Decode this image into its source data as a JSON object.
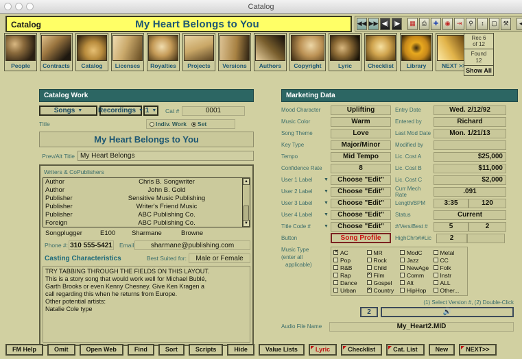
{
  "window": {
    "title": "Catalog"
  },
  "banner": {
    "module_label": "Catalog",
    "record_title": "My Heart Belongs to You"
  },
  "fm_toolbar": {
    "buttons": [
      {
        "name": "go-to-first-record",
        "glyph": "◀◀"
      },
      {
        "name": "go-to-last-record",
        "glyph": "▶▶"
      },
      {
        "name": "previous-record",
        "glyph": "◀|"
      },
      {
        "name": "next-record",
        "glyph": "|▶"
      },
      {
        "name": "layout-mode",
        "glyph": "▤"
      },
      {
        "name": "print",
        "glyph": "⎙"
      },
      {
        "name": "new-record",
        "glyph": "✚"
      },
      {
        "name": "delete-record",
        "glyph": "◉"
      },
      {
        "name": "export",
        "glyph": "⇥"
      },
      {
        "name": "find",
        "glyph": "🔍"
      },
      {
        "name": "sort",
        "glyph": "⬍"
      },
      {
        "name": "trash",
        "glyph": "Ὕ1"
      },
      {
        "name": "script",
        "glyph": "⚒"
      },
      {
        "name": "collapse-toolbar",
        "glyph": "◀"
      }
    ]
  },
  "record_counter": {
    "record_line1": "Rec 6",
    "record_line2": "of 12",
    "found_line1": "Found",
    "found_line2": "12",
    "show_all": "Show All"
  },
  "nav_tiles": [
    {
      "label": "People"
    },
    {
      "label": "Contracts"
    },
    {
      "label": "Catalog"
    },
    {
      "label": "Licenses"
    },
    {
      "label": "Royalties"
    },
    {
      "label": "Projects"
    },
    {
      "label": "Versions"
    },
    {
      "label": "Authors"
    },
    {
      "label": "Copyright"
    },
    {
      "label": "Lyric"
    },
    {
      "label": "Checklist"
    },
    {
      "label": "Library"
    },
    {
      "label": "NEXT >>"
    }
  ],
  "catalog_work": {
    "header": "Catalog Work",
    "songs_button": "Songs",
    "recordings_button": "Recordings",
    "version_number": "1",
    "cat_number_label": "Cat #",
    "cat_number_value": "0001",
    "title_label": "Title",
    "scope_indiv_label": "Indiv. Work",
    "scope_set_label": "Set",
    "scope_selected": "Set",
    "title_value": "My Heart Belongs to You",
    "prev_alt_title_label": "Prev/Alt Title",
    "prev_alt_title_value": "My Heart Belongs",
    "writers_header": "Writers & CoPublishers",
    "writers_rows": [
      {
        "type": "Author",
        "name": "Chris B. Songwriter"
      },
      {
        "type": "Author",
        "name": "John B. Gold"
      },
      {
        "type": "Publisher",
        "name": "Sensitive Music Publishing"
      },
      {
        "type": "Publisher",
        "name": "Writer's Friend Music"
      },
      {
        "type": "Publisher",
        "name": "ABC Publishing Co."
      },
      {
        "type": "Foreign",
        "name": "ABC Publishing Co."
      }
    ],
    "songplugger_role": "Songplugger",
    "songplugger_code": "E100",
    "songplugger_first": "Sharmane",
    "songplugger_last": "Browne",
    "phone_label": "Phone #:",
    "phone_value": "310 555-5421",
    "email_label": "Email",
    "email_value": "sharmane@publishing.com",
    "casting_header": "Casting Characteristics",
    "best_suited_label": "Best Suited for:",
    "best_suited_value": "Male or Female",
    "notes": "TRY TABBING THROUGH THE FIELDS ON THIS LAYOUT.\nThis is a story song that would work well for Michael Bublé,\nGarth Brooks or even Kenny Chesney. Give Ken Kragen a\ncall regarding this when he returns from Europe.\nOther potential artists:\nNatalie Cole type"
  },
  "marketing": {
    "header": "Marketing Data",
    "left_rows": [
      {
        "label": "Mood Character",
        "value": "Uplifting",
        "has_caret": false
      },
      {
        "label": "Music Color",
        "value": "Warm",
        "has_caret": false
      },
      {
        "label": "Song Theme",
        "value": "Love",
        "has_caret": false
      },
      {
        "label": "Key Type",
        "value": "Major/Minor",
        "has_caret": false
      },
      {
        "label": "Tempo",
        "value": "Mid Tempo",
        "has_caret": false
      },
      {
        "label": "Confidence Rate",
        "value": "8",
        "has_caret": false
      },
      {
        "label": "User 1 Label",
        "value": "Choose \"Edit\"",
        "has_caret": true
      },
      {
        "label": "User 2 Label",
        "value": "Choose \"Edit\"",
        "has_caret": true
      },
      {
        "label": "User 3 Label",
        "value": "Choose \"Edit\"",
        "has_caret": true
      },
      {
        "label": "User 4 Label",
        "value": "Choose \"Edit\"",
        "has_caret": true
      },
      {
        "label": "Title Code #",
        "value": "Choose \"Edit\"",
        "has_caret": true
      }
    ],
    "right_rows": [
      {
        "label": "Entry Date",
        "value": "Wed. 2/12/92",
        "align": "center"
      },
      {
        "label": "Entered by",
        "value": "Richard",
        "align": "center"
      },
      {
        "label": "Last Mod Date",
        "value": "Mon. 1/21/13",
        "align": "center"
      },
      {
        "label": "Modified by",
        "value": "",
        "align": "center"
      },
      {
        "label": "Lic. Cost A",
        "value": "$25,000",
        "align": "right"
      },
      {
        "label": "Lic. Cost B",
        "value": "$11,000",
        "align": "right"
      },
      {
        "label": "Lic. Cost C",
        "value": "$2,000",
        "align": "right"
      },
      {
        "label": "Curr Mech Rate",
        "value": ".091",
        "align": "center"
      }
    ],
    "length_bpm_label": "Length/BPM",
    "length_value": "3:35",
    "bpm_value": "120",
    "status_label": "Status",
    "status_value": "Current",
    "vers_best_label": "#/Vers/Best #",
    "vers_value": "5",
    "best_value": "2",
    "button_label": "Button",
    "song_profile_button": "Song Profile",
    "highchrt_label": "HighChrt#/#Lic",
    "highchrt_value": "2",
    "highchrt_value2": "",
    "music_type_label_1": "Music Type",
    "music_type_label_2": "(enter all",
    "music_type_label_3": "applicable)",
    "music_types": [
      {
        "label": "AC",
        "checked": true
      },
      {
        "label": "MR",
        "checked": false
      },
      {
        "label": "ModC",
        "checked": false
      },
      {
        "label": "Metal",
        "checked": false
      },
      {
        "label": "Pop",
        "checked": false
      },
      {
        "label": "Rock",
        "checked": false
      },
      {
        "label": "Jazz",
        "checked": false
      },
      {
        "label": "CC",
        "checked": false
      },
      {
        "label": "R&B",
        "checked": false
      },
      {
        "label": "Child",
        "checked": false
      },
      {
        "label": "NewAge",
        "checked": false
      },
      {
        "label": "Folk",
        "checked": false
      },
      {
        "label": "Rap",
        "checked": false
      },
      {
        "label": "Film",
        "checked": true
      },
      {
        "label": "Comm",
        "checked": false
      },
      {
        "label": "Instr",
        "checked": false
      },
      {
        "label": "Dance",
        "checked": false
      },
      {
        "label": "Gospel",
        "checked": false
      },
      {
        "label": "Alt",
        "checked": false
      },
      {
        "label": "ALL",
        "checked": false
      },
      {
        "label": "Urban",
        "checked": false
      },
      {
        "label": "Country",
        "checked": true
      },
      {
        "label": "HipHop",
        "checked": false
      },
      {
        "label": "Other...",
        "checked": false
      }
    ],
    "version_hint": "(1) Select Version #, (2) Double-Click",
    "version_number": "2",
    "play_icon": "speaker-icon",
    "audio_file_label": "Audio File Name",
    "audio_file_value": "My_Heart2.MID"
  },
  "bottom_buttons": [
    {
      "label": "FM Help",
      "flag": false,
      "red": false
    },
    {
      "label": "Omit",
      "flag": false,
      "red": false
    },
    {
      "label": "Open Web",
      "flag": false,
      "red": false
    },
    {
      "label": "Find",
      "flag": false,
      "red": false
    },
    {
      "label": "Sort",
      "flag": false,
      "red": false
    },
    {
      "label": "Scripts",
      "flag": false,
      "red": false
    },
    {
      "label": "Hide",
      "flag": false,
      "red": false
    },
    {
      "label": "Value Lists",
      "flag": false,
      "red": false
    },
    {
      "label": "Lyric",
      "flag": true,
      "red": true
    },
    {
      "label": "Checklist",
      "flag": true,
      "red": false
    },
    {
      "label": "Cat. List",
      "flag": true,
      "red": false
    },
    {
      "label": "New",
      "flag": false,
      "red": false
    },
    {
      "label": "NEXT>>",
      "flag": true,
      "red": false
    }
  ],
  "colors": {
    "canvas": "#d1d0a1",
    "panel_header": "#2c6663",
    "banner": "#ffff66",
    "title_blue": "#1c5672",
    "accent_red": "#c01414"
  }
}
